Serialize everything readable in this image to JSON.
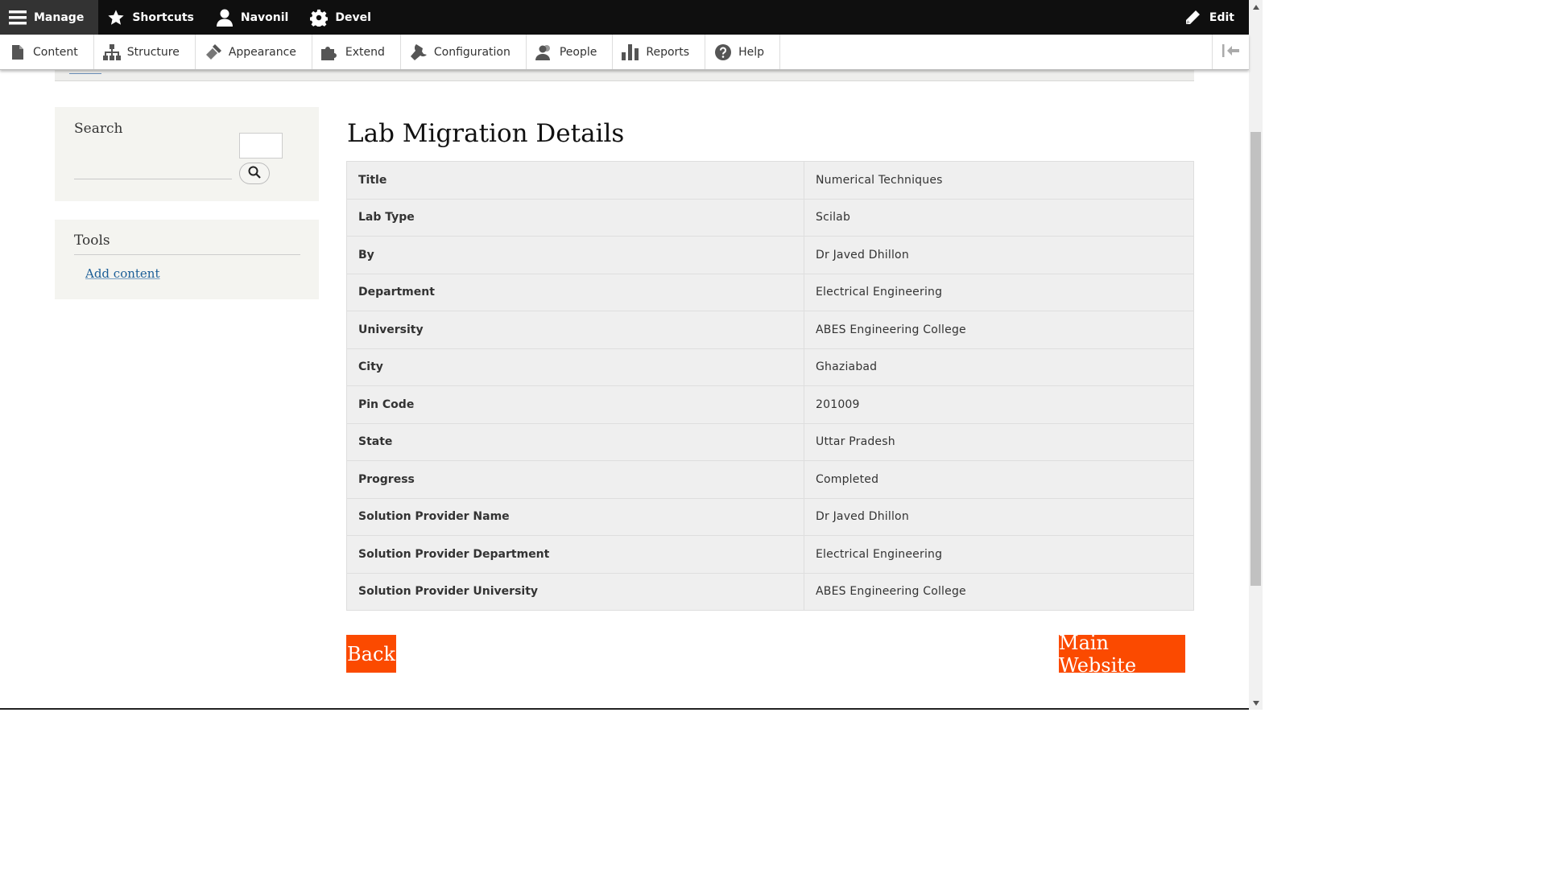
{
  "toolbar": {
    "manage": "Manage",
    "shortcuts": "Shortcuts",
    "user": "Navonil",
    "devel": "Devel",
    "edit": "Edit"
  },
  "tray": {
    "items": [
      "Content",
      "Structure",
      "Appearance",
      "Extend",
      "Configuration",
      "People",
      "Reports",
      "Help"
    ]
  },
  "sidebar": {
    "search_title": "Search",
    "tools_title": "Tools",
    "add_content": "Add content"
  },
  "main": {
    "title": "Lab Migration Details",
    "rows": [
      {
        "label": "Title",
        "value": "Numerical Techniques"
      },
      {
        "label": "Lab Type",
        "value": "Scilab"
      },
      {
        "label": "By",
        "value": "Dr Javed Dhillon"
      },
      {
        "label": "Department",
        "value": "Electrical Engineering"
      },
      {
        "label": "University",
        "value": "ABES Engineering College"
      },
      {
        "label": "City",
        "value": "Ghaziabad"
      },
      {
        "label": "Pin Code",
        "value": "201009"
      },
      {
        "label": "State",
        "value": "Uttar Pradesh"
      },
      {
        "label": "Progress",
        "value": "Completed"
      },
      {
        "label": "Solution Provider Name",
        "value": "Dr Javed Dhillon"
      },
      {
        "label": "Solution Provider Department",
        "value": "Electrical Engineering"
      },
      {
        "label": "Solution Provider University",
        "value": "ABES Engineering College"
      }
    ],
    "back_label": "Back",
    "main_website_label": "Main Website"
  },
  "colors": {
    "accent_orange": "#fb4a00",
    "toolbar_black": "#0f0f0f",
    "link_blue": "#1b5e97"
  }
}
